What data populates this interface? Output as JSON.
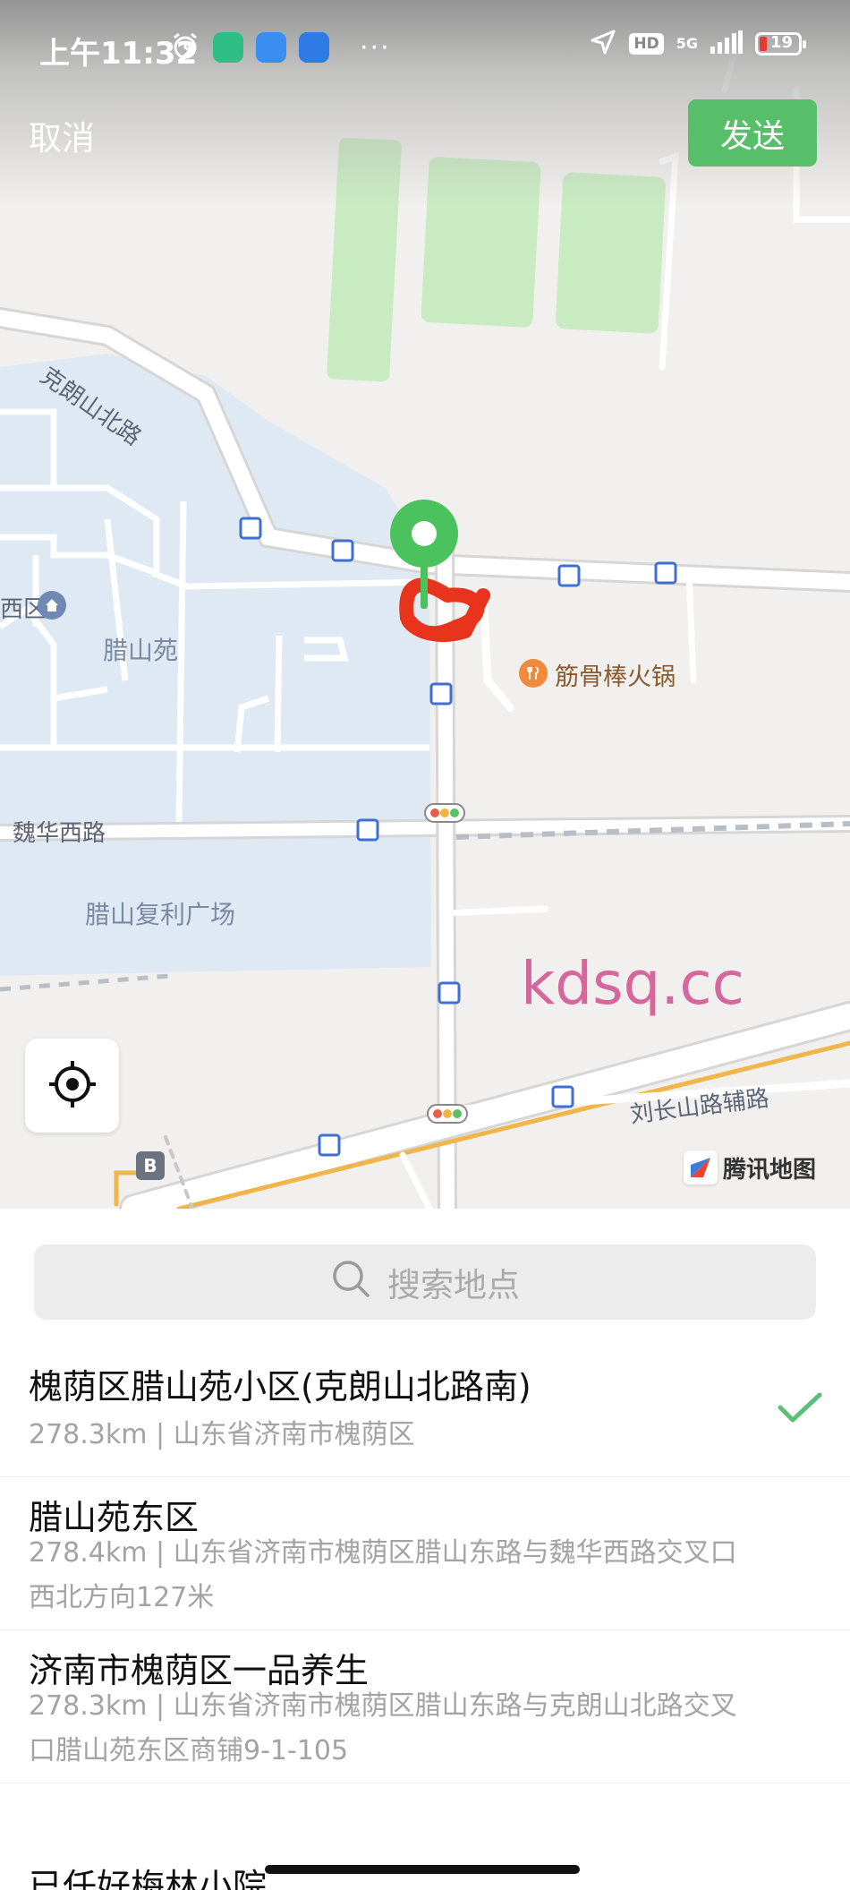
{
  "status_bar": {
    "time": "上午11:32",
    "network": "5G",
    "hd_badge": "HD",
    "battery_percent": "19",
    "more": "···"
  },
  "header": {
    "cancel_label": "取消",
    "send_label": "发送"
  },
  "map": {
    "road_labels": [
      "克朗山北路",
      "魏华西路",
      "刘长山路辅路"
    ],
    "area_labels": [
      "腊山苑",
      "腊山复利广场",
      "西区"
    ],
    "poi_name": "筋骨棒火锅",
    "provider_label": "腾讯地图",
    "watermark": "kdsq.cc",
    "marker_letter": "B"
  },
  "search": {
    "placeholder": "搜索地点"
  },
  "results": [
    {
      "title": "槐荫区腊山苑小区(克朗山北路南)",
      "subtitle": "278.3km | 山东省济南市槐荫区",
      "selected": true
    },
    {
      "title": "腊山苑东区",
      "subtitle": "278.4km | 山东省济南市槐荫区腊山东路与魏华西路交叉口西北方向127米",
      "selected": false
    },
    {
      "title": "济南市槐荫区一品养生",
      "subtitle": "278.3km | 山东省济南市槐荫区腊山东路与克朗山北路交叉口腊山苑东区商铺9-1-105",
      "selected": false
    },
    {
      "title": "已任好梅林小院",
      "subtitle": "",
      "selected": false
    }
  ],
  "colors": {
    "accent_green": "#57be6a",
    "check_green": "#5bbf7a",
    "map_water": "#dfe9f4",
    "map_park": "#c9ebc2",
    "pin_green": "#4cc25f",
    "scribble_red": "#e8341c",
    "road_orange": "#f0b64a"
  }
}
